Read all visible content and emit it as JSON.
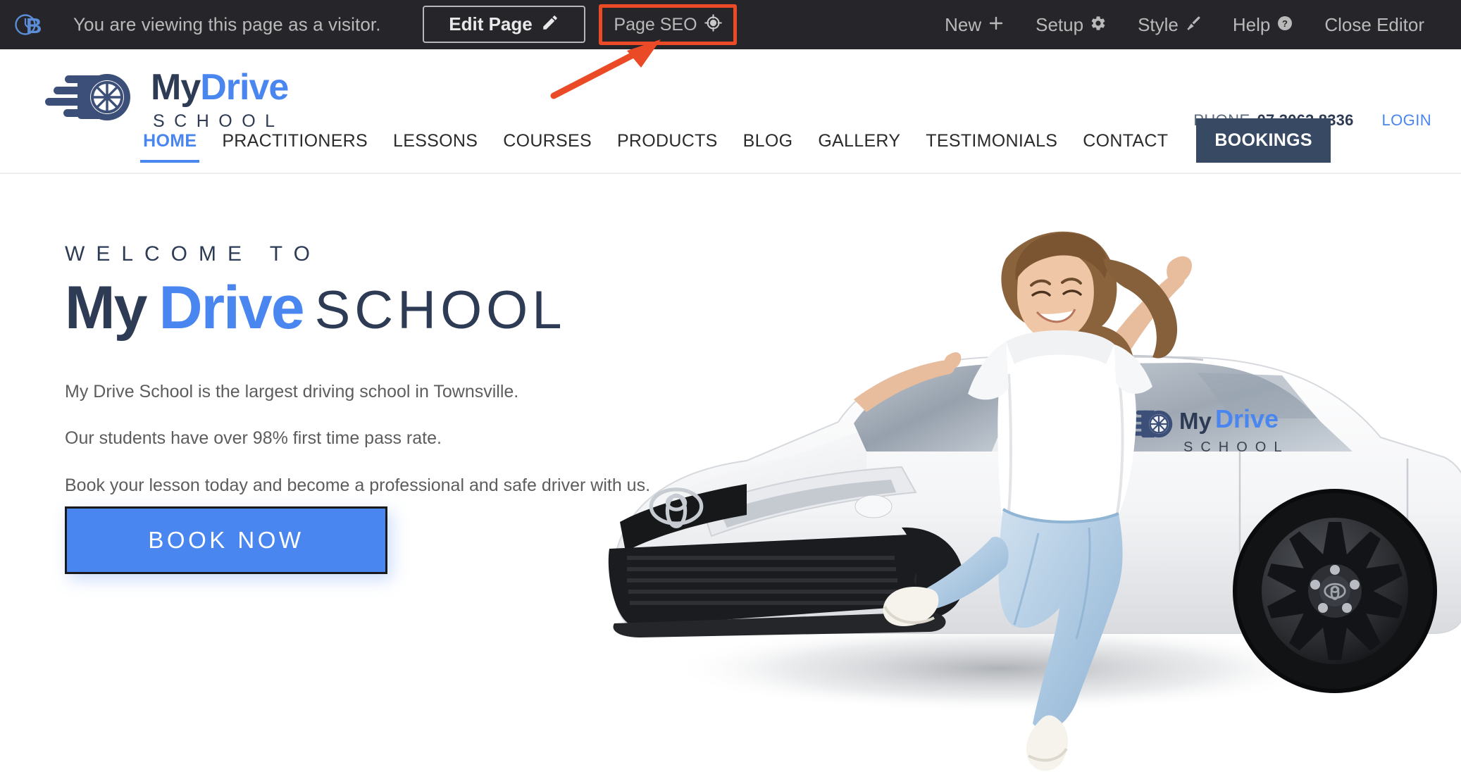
{
  "editor_bar": {
    "brand_icon": "brandcrock-b-logo-icon",
    "visitor_notice": "You are viewing this page as a visitor.",
    "edit_page": {
      "label": "Edit Page",
      "icon": "pencil-icon"
    },
    "page_seo": {
      "label": "Page SEO",
      "icon": "crosshair-target-icon",
      "highlight_color": "#ea4b26"
    },
    "right_items": [
      {
        "label": "New",
        "icon": "plus-icon"
      },
      {
        "label": "Setup",
        "icon": "gear-icon"
      },
      {
        "label": "Style",
        "icon": "paintbrush-icon"
      },
      {
        "label": "Help",
        "icon": "question-circle-icon"
      },
      {
        "label": "Close Editor",
        "icon": "none"
      }
    ],
    "background_color": "#26262a",
    "text_color": "#b9b9ba"
  },
  "site_header": {
    "logo": {
      "icon": "speeding-wheel-icon",
      "word_my": "My",
      "word_drive": "Drive",
      "word_school": "SCHOOL"
    },
    "utility": {
      "phone_label": "PHONE",
      "phone_number": "07 3062 8336",
      "login_label": "LOGIN"
    },
    "nav_items": [
      {
        "label": "HOME",
        "active": true
      },
      {
        "label": "PRACTITIONERS",
        "active": false
      },
      {
        "label": "LESSONS",
        "active": false
      },
      {
        "label": "COURSES",
        "active": false
      },
      {
        "label": "PRODUCTS",
        "active": false
      },
      {
        "label": "BLOG",
        "active": false
      },
      {
        "label": "GALLERY",
        "active": false
      },
      {
        "label": "TESTIMONIALS",
        "active": false
      },
      {
        "label": "CONTACT",
        "active": false
      }
    ],
    "cta": {
      "label": "BOOKINGS",
      "background_color": "#384964"
    }
  },
  "hero": {
    "eyebrow": "WELCOME TO",
    "title_my": "My",
    "title_drive": "Drive",
    "title_school": "SCHOOL",
    "paragraphs": [
      "My Drive School is the largest driving school in Townsville.",
      "Our students have over 98% first time pass rate.",
      "Book your lesson today and become a professional and safe driver with us."
    ],
    "cta": {
      "label": "BOOK NOW",
      "background_color": "#4a86f0"
    },
    "artwork": {
      "description": "jumping-woman-beside-white-toyota-corolla-photo",
      "car_decal_my": "My",
      "car_decal_drive": "Drive",
      "car_decal_school": "SCHOOL"
    }
  },
  "annotation": {
    "arrow_color": "#ea4b26",
    "points_to": "page-seo-button"
  },
  "colors": {
    "accent_blue": "#4a86f0",
    "navy": "#2e3b55",
    "dark_bar": "#26262a",
    "highlight_red": "#ea4b26"
  }
}
